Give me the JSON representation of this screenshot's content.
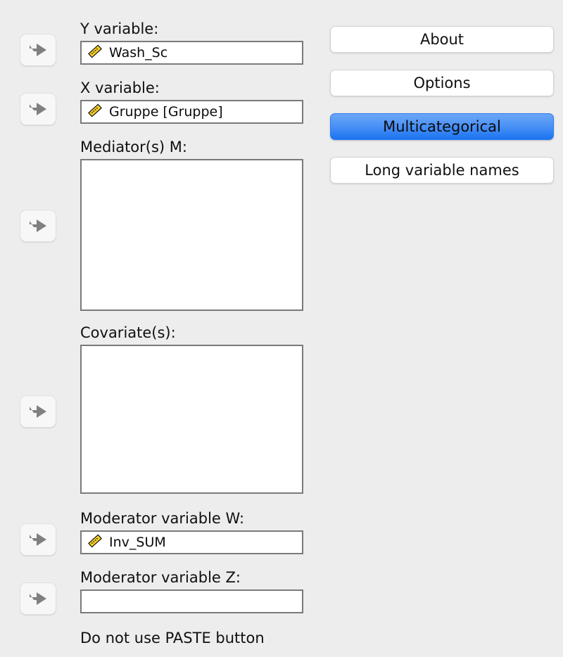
{
  "dialog": {
    "background_color": "#ededed",
    "accent_color": "#1a74f1"
  },
  "icons": {
    "ruler": "ruler-scale-icon",
    "arrow": "push-right-arrow-icon"
  },
  "fields": [
    {
      "label": "Y variable:",
      "value": "Wash_Sc",
      "placeholder": "",
      "has_icon": true,
      "type": "single"
    },
    {
      "label": "X variable:",
      "value": "Gruppe [Gruppe]",
      "placeholder": "",
      "has_icon": true,
      "type": "single"
    },
    {
      "label": "Mediator(s) M:",
      "value": "",
      "placeholder": "",
      "has_icon": false,
      "type": "list"
    },
    {
      "label": "Covariate(s):",
      "value": "",
      "placeholder": "",
      "has_icon": false,
      "type": "list"
    },
    {
      "label": "Moderator variable W:",
      "value": "Inv_SUM",
      "placeholder": "",
      "has_icon": true,
      "type": "single"
    },
    {
      "label": "Moderator variable Z:",
      "value": "",
      "placeholder": "",
      "has_icon": false,
      "type": "single"
    }
  ],
  "arrow_buttons": [
    {
      "name": "move-to-y-variable"
    },
    {
      "name": "move-to-x-variable"
    },
    {
      "name": "move-to-mediators"
    },
    {
      "name": "move-to-covariates"
    },
    {
      "name": "move-to-moderator-w"
    },
    {
      "name": "move-to-moderator-z"
    }
  ],
  "side_buttons": [
    {
      "label": "About",
      "selected": false
    },
    {
      "label": "Options",
      "selected": false
    },
    {
      "label": "Multicategorical",
      "selected": true
    },
    {
      "label": "Long variable names",
      "selected": false
    }
  ],
  "footer": {
    "note": "Do not use PASTE button"
  }
}
